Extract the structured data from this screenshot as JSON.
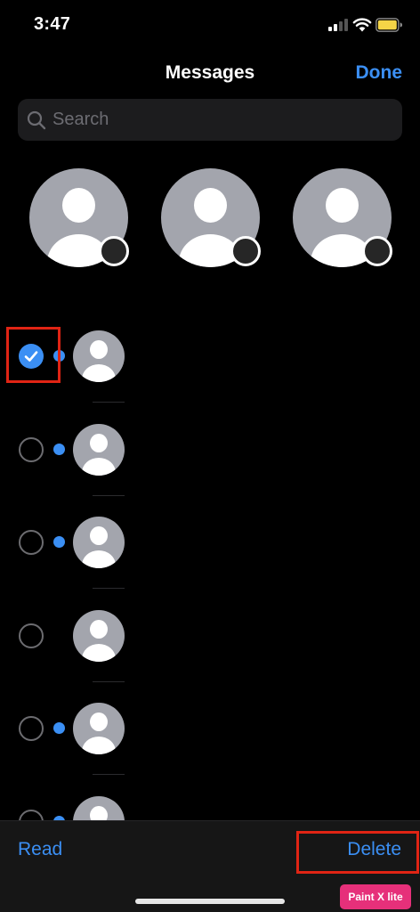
{
  "status_bar": {
    "time": "3:47"
  },
  "nav": {
    "title": "Messages",
    "done_label": "Done"
  },
  "search": {
    "placeholder": "Search"
  },
  "pinned": [
    {
      "avatar": "person-icon",
      "badge": "dark-dot"
    },
    {
      "avatar": "person-icon",
      "badge": "dark-dot"
    },
    {
      "avatar": "person-icon",
      "badge": "dark-dot"
    }
  ],
  "conversations": [
    {
      "selected": true,
      "unread": true
    },
    {
      "selected": false,
      "unread": true
    },
    {
      "selected": false,
      "unread": true
    },
    {
      "selected": false,
      "unread": false
    },
    {
      "selected": false,
      "unread": true
    },
    {
      "selected": false,
      "unread": true
    }
  ],
  "toolbar": {
    "read_label": "Read",
    "delete_label": "Delete"
  },
  "watermark": "Paint X lite",
  "colors": {
    "accent": "#3b8ff4",
    "highlight": "#e02414",
    "avatar": "#a3a5ad"
  }
}
